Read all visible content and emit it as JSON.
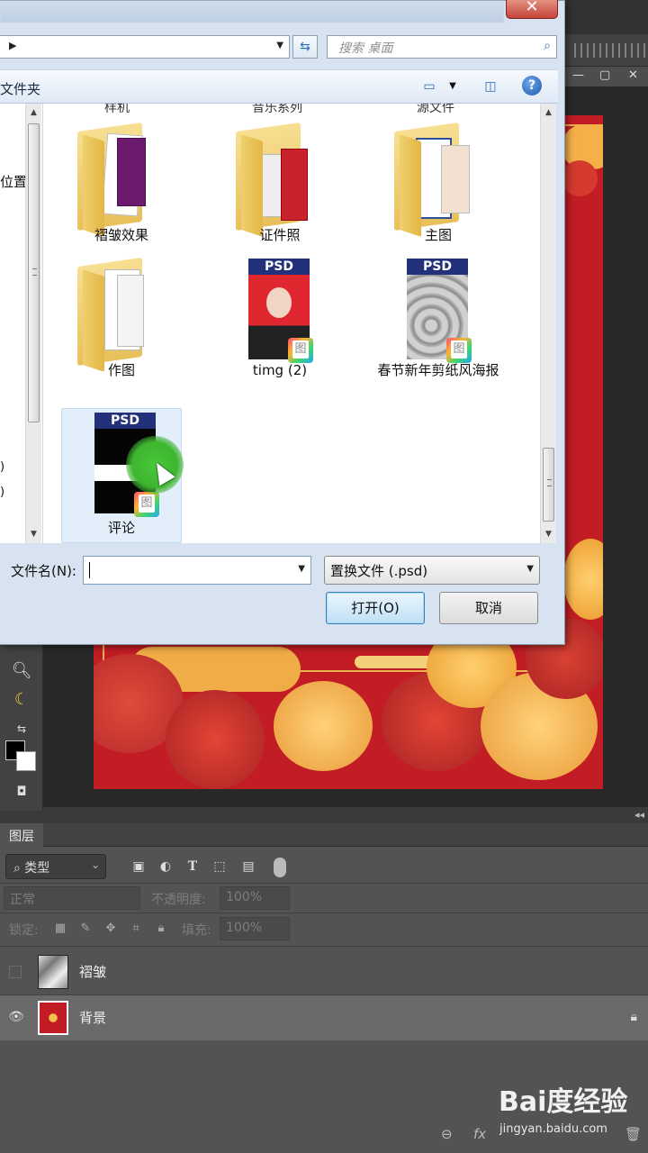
{
  "dialog": {
    "search_placeholder": "搜索 桌面",
    "new_folder_label": "文件夹",
    "nav_label": "位置",
    "top_cut_labels": [
      "样机",
      "音乐系列",
      "源文件"
    ],
    "files": [
      {
        "name": "褶皱效果",
        "kind": "folder"
      },
      {
        "name": "证件照",
        "kind": "folder"
      },
      {
        "name": "主图",
        "kind": "folder"
      },
      {
        "name": "作图",
        "kind": "folder"
      },
      {
        "name": "timg (2)",
        "kind": "psd"
      },
      {
        "name": "春节新年剪纸风海报",
        "kind": "psd"
      },
      {
        "name": "评论",
        "kind": "psd"
      }
    ],
    "psd_badge": "PSD",
    "filename_label": "文件名(N):",
    "filename_value": "",
    "filetype_value": "置换文件 (.psd)",
    "open_button": "打开(O)",
    "cancel_button": "取消"
  },
  "photoshop": {
    "layers_tab": "图层",
    "filter_kind": "类型",
    "blend_mode": "正常",
    "opacity_label": "不透明度:",
    "opacity_value": "100%",
    "lock_label": "锁定:",
    "fill_label": "填充:",
    "fill_value": "100%",
    "layers": [
      {
        "name": "褶皱",
        "visible": false
      },
      {
        "name": "背景",
        "visible": true,
        "locked": true
      }
    ]
  },
  "watermark": {
    "brand": "Bai度经验",
    "url": "jingyan.baidu.com"
  },
  "colors": {
    "poster_red": "#c21d24",
    "selection_blue": "#e2eef9",
    "cursor_green": "#3eb52f"
  }
}
